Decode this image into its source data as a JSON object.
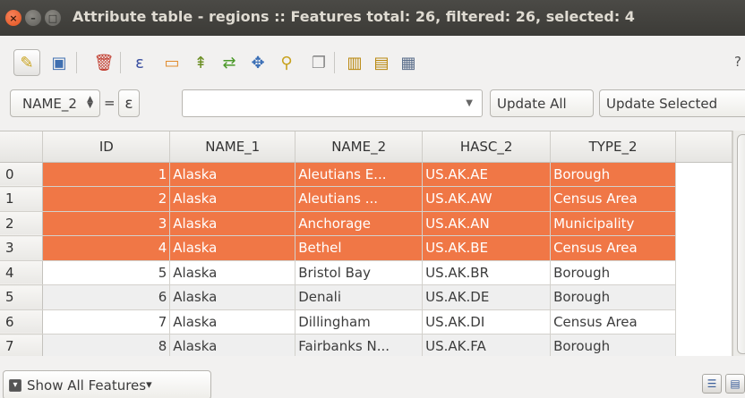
{
  "window": {
    "title": "Attribute table - regions :: Features total: 26, filtered: 26, selected: 4",
    "close_glyph": "×",
    "min_glyph": "–",
    "max_glyph": "□"
  },
  "toolbar": {
    "tools": [
      {
        "name": "toggle-editing-icon",
        "glyph": "✎",
        "color": "#c9a21b"
      },
      {
        "name": "save-edits-icon",
        "glyph": "▣",
        "color": "#3f6fb0"
      },
      {
        "name": "delete-selected-icon",
        "glyph": "🗑",
        "color": "#c0392b"
      },
      {
        "name": "select-by-expression-icon",
        "glyph": "ε",
        "color": "#3a4fa0"
      },
      {
        "name": "deselect-all-icon",
        "glyph": "▭",
        "color": "#e08a2c"
      },
      {
        "name": "move-selection-top-icon",
        "glyph": "⇞",
        "color": "#6b8e23"
      },
      {
        "name": "invert-selection-icon",
        "glyph": "⇄",
        "color": "#4c9a2a"
      },
      {
        "name": "pan-to-selected-icon",
        "glyph": "✥",
        "color": "#3b6fb6"
      },
      {
        "name": "zoom-to-selected-icon",
        "glyph": "⚲",
        "color": "#c8a21e"
      },
      {
        "name": "copy-rows-icon",
        "glyph": "❐",
        "color": "#8a8a8a"
      },
      {
        "name": "delete-column-icon",
        "glyph": "▥",
        "color": "#b8860b"
      },
      {
        "name": "new-column-icon",
        "glyph": "▤",
        "color": "#b8860b"
      },
      {
        "name": "field-calculator-icon",
        "glyph": "▦",
        "color": "#5a6d8a"
      }
    ],
    "help_label": "?"
  },
  "filter": {
    "field_value": "NAME_2",
    "spin_up": "▲",
    "spin_down": "▼",
    "equals_label": "=",
    "expression_button_label": "ε",
    "value_text": "",
    "dropdown_glyph": "▼",
    "update_all_label": "Update All",
    "update_selected_label": "Update Selected"
  },
  "table": {
    "columns": [
      "ID",
      "NAME_1",
      "NAME_2",
      "HASC_2",
      "TYPE_2"
    ],
    "sort_glyph": "▲",
    "rows": [
      {
        "row": "0",
        "id": "1",
        "name_1": "Alaska",
        "name_2": "Aleutians E...",
        "hasc_2": "US.AK.AE",
        "type_2": "Borough",
        "selected": true
      },
      {
        "row": "1",
        "id": "2",
        "name_1": "Alaska",
        "name_2": "Aleutians ...",
        "hasc_2": "US.AK.AW",
        "type_2": "Census Area",
        "selected": true
      },
      {
        "row": "2",
        "id": "3",
        "name_1": "Alaska",
        "name_2": "Anchorage",
        "hasc_2": "US.AK.AN",
        "type_2": "Municipality",
        "selected": true
      },
      {
        "row": "3",
        "id": "4",
        "name_1": "Alaska",
        "name_2": "Bethel",
        "hasc_2": "US.AK.BE",
        "type_2": "Census Area",
        "selected": true
      },
      {
        "row": "4",
        "id": "5",
        "name_1": "Alaska",
        "name_2": "Bristol Bay",
        "hasc_2": "US.AK.BR",
        "type_2": "Borough",
        "selected": false
      },
      {
        "row": "5",
        "id": "6",
        "name_1": "Alaska",
        "name_2": "Denali",
        "hasc_2": "US.AK.DE",
        "type_2": "Borough",
        "selected": false
      },
      {
        "row": "6",
        "id": "7",
        "name_1": "Alaska",
        "name_2": "Dillingham",
        "hasc_2": "US.AK.DI",
        "type_2": "Census Area",
        "selected": false
      },
      {
        "row": "7",
        "id": "8",
        "name_1": "Alaska",
        "name_2": "Fairbanks N...",
        "hasc_2": "US.AK.FA",
        "type_2": "Borough",
        "selected": false
      }
    ]
  },
  "bottom": {
    "filter_icon_glyph": "▾",
    "show_all_label": "Show All Features",
    "dropdown_glyph": "▾",
    "table_view_glyph": "☰",
    "form_view_glyph": "▤"
  },
  "colors": {
    "selection": "#f07746",
    "titlebar": "#3c3b37"
  }
}
